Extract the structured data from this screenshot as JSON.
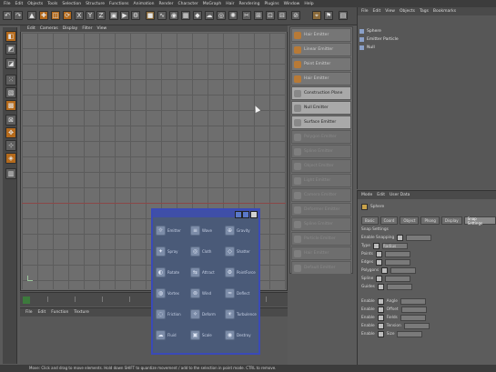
{
  "menubar": [
    "File",
    "Edit",
    "Objects",
    "Tools",
    "Selection",
    "Structure",
    "Functions",
    "Animation",
    "Render",
    "Character",
    "MoGraph",
    "Hair",
    "Rendering",
    "Plugins",
    "Window",
    "Help"
  ],
  "viewport": {
    "menu": [
      "Edit",
      "Cameras",
      "Display",
      "Filter",
      "View"
    ]
  },
  "create_menu": {
    "items": [
      {
        "label": "Hair Emitter",
        "state": "normal"
      },
      {
        "label": "Linear Emitter",
        "state": "normal"
      },
      {
        "label": "Point Emitter",
        "state": "normal"
      },
      {
        "label": "Hair Emitter",
        "state": "normal"
      },
      {
        "label": "Construction Plane",
        "state": "hl"
      },
      {
        "label": "Null Emitter",
        "state": "hl"
      },
      {
        "label": "Surface Emitter",
        "state": "hl"
      },
      {
        "label": "Polygon Emitter",
        "state": "dim"
      },
      {
        "label": "Spline Emitter",
        "state": "dim"
      },
      {
        "label": "Object Emitter",
        "state": "dim"
      },
      {
        "label": "Light Emitter",
        "state": "dim"
      },
      {
        "label": "Camera Emitter",
        "state": "dim"
      },
      {
        "label": "Deformer Emitter",
        "state": "dim"
      },
      {
        "label": "Spline Emitter",
        "state": "dim"
      },
      {
        "label": "Particle Emitter",
        "state": "dim"
      },
      {
        "label": "Hair Emitter",
        "state": "dim"
      },
      {
        "label": "Default Emitter",
        "state": "dim"
      }
    ]
  },
  "object_manager": {
    "menu": [
      "File",
      "Edit",
      "View",
      "Objects",
      "Tags",
      "Bookmarks"
    ],
    "rows": [
      "Sphere",
      "Emitter Particle",
      "Null"
    ]
  },
  "attributes": {
    "menu": [
      "Mode",
      "Edit",
      "User Data"
    ],
    "object_name": "Sphere",
    "tabs": [
      "Basic",
      "Coord",
      "Object",
      "Phong",
      "Display",
      "Snap Settings"
    ],
    "section": "Snap Settings",
    "rows": [
      {
        "label": "Enable Snapping",
        "value": ""
      },
      {
        "label": "Type",
        "value": "Radius"
      },
      {
        "label": "Points",
        "value": ""
      },
      {
        "label": "Edges",
        "value": ""
      },
      {
        "label": "Polygons",
        "value": ""
      },
      {
        "label": "Spline",
        "value": ""
      },
      {
        "label": "Guides",
        "value": ""
      }
    ],
    "lower_rows": [
      "Enable",
      "Enable",
      "Enable",
      "Enable",
      "Enable"
    ],
    "lower_labels": [
      "Angle",
      "Offset",
      "Fields",
      "Tension",
      "Size"
    ]
  },
  "material_manager": {
    "menu": [
      "File",
      "Edit",
      "Function",
      "Texture"
    ]
  },
  "status": {
    "text": "Move: Click and drag to move elements. Hold down SHIFT to quantize movement / add to the selection in point mode. CTRL to remove."
  },
  "palette": {
    "items": [
      {
        "icon": "☼",
        "label": "Emitter"
      },
      {
        "icon": "≡",
        "label": "Wave"
      },
      {
        "icon": "⊕",
        "label": "Gravity"
      },
      {
        "icon": "✦",
        "label": "Spray"
      },
      {
        "icon": "◎",
        "label": "Cloth"
      },
      {
        "icon": "◇",
        "label": "Shatter"
      },
      {
        "icon": "◐",
        "label": "Rotate"
      },
      {
        "icon": "⇆",
        "label": "Attract"
      },
      {
        "icon": "⚙",
        "label": "PointForce"
      },
      {
        "icon": "◍",
        "label": "Vortex"
      },
      {
        "icon": "⊚",
        "label": "Wind"
      },
      {
        "icon": "≈",
        "label": "Deflect"
      },
      {
        "icon": "◌",
        "label": "Friction"
      },
      {
        "icon": "✧",
        "label": "Deform"
      },
      {
        "icon": "☀",
        "label": "Turbulence"
      },
      {
        "icon": "☁",
        "label": "Fluid"
      },
      {
        "icon": "▣",
        "label": "Scale"
      },
      {
        "icon": "◉",
        "label": "Destroy"
      }
    ]
  }
}
